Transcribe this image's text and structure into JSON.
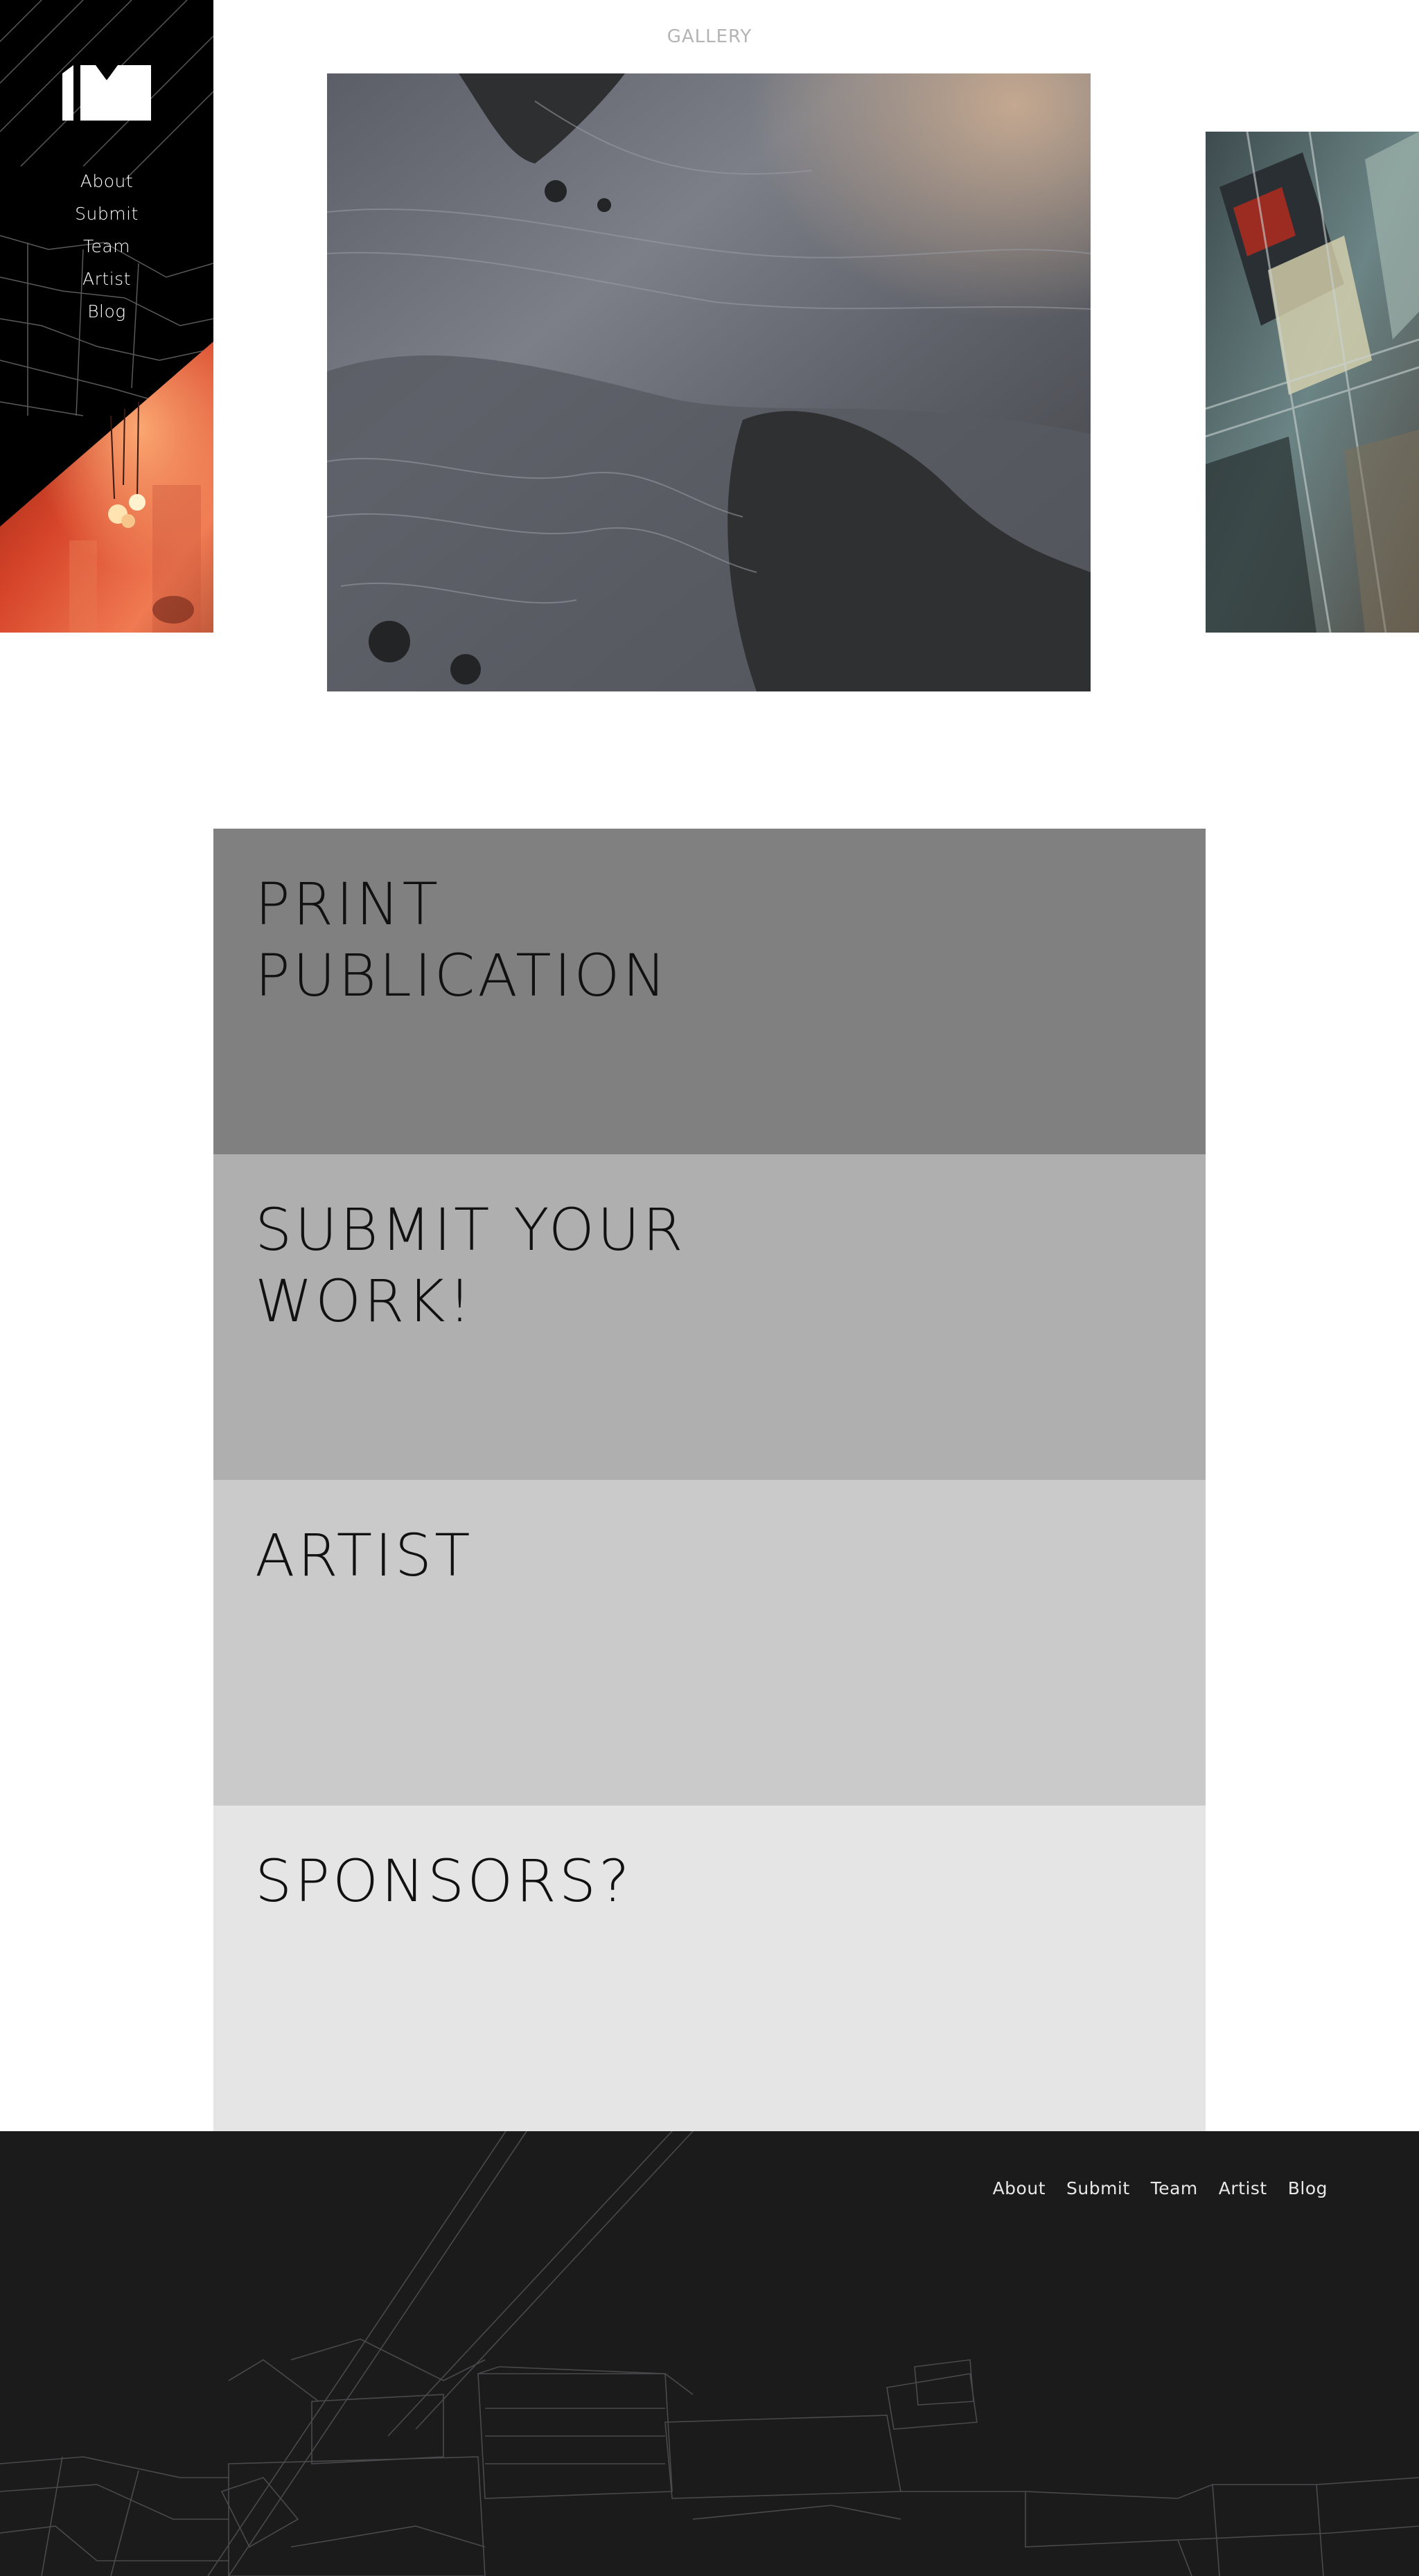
{
  "sidebar": {
    "logo_name": "logo-im",
    "nav": [
      "About",
      "Submit",
      "Team",
      "Artist",
      "Blog"
    ]
  },
  "gallery": {
    "title": "GALLERY"
  },
  "features": [
    {
      "title": "PRINT\nPUBLICATION",
      "color": "#808080"
    },
    {
      "title": "SUBMIT YOUR\nWORK!",
      "color": "#afafaf"
    },
    {
      "title": "ARTIST",
      "color": "#cacaca"
    },
    {
      "title": "SPONSORS?",
      "color": "#e5e5e5"
    }
  ],
  "footer": {
    "nav": [
      "About",
      "Submit",
      "Team",
      "Artist",
      "Blog"
    ],
    "background": "#1b1b1c"
  }
}
